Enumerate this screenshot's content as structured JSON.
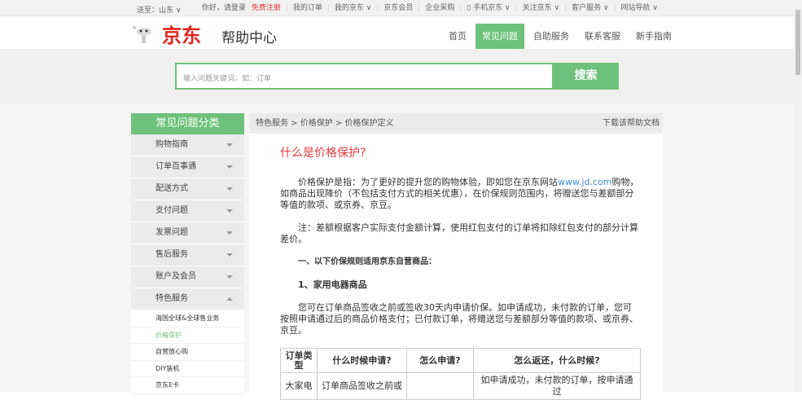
{
  "topbar": {
    "location": "送至：山东 ∨",
    "links": [
      "你好，请登录",
      "免费注册",
      "我的订单",
      "我的京东 ∨",
      "京东会员",
      "企业采购",
      "▯ 手机京东 ∨",
      "关注京东 ∨",
      "客户服务 ∨",
      "网站导航 ∨"
    ]
  },
  "header": {
    "logo": "京东",
    "title": "帮助中心",
    "nav": [
      "首页",
      "常见问题",
      "自助服务",
      "联系客服",
      "新手指南"
    ]
  },
  "search": {
    "placeholder": "输入问题关键词，如：订单",
    "button": "搜索"
  },
  "sidebar": {
    "title": "常见问题分类",
    "items": [
      "购物指南",
      "订单百事通",
      "配送方式",
      "支付问题",
      "发票问题",
      "售后服务",
      "账户及会员",
      "特色服务"
    ],
    "subitems": [
      "海国全球&全球售业务",
      "价格保护",
      "自营放心购",
      "DIY装机",
      "京东E卡"
    ]
  },
  "breadcrumb": {
    "path": "特色服务 > 价格保护 > 价格保护定义",
    "download": "下载该帮助文档"
  },
  "article": {
    "title": "什么是价格保护?",
    "p1a": "价格保护是指：为了更好的提升您的购物体验，即如您在京东网站",
    "link": "www.jd.com",
    "p1b": "购物，如商品出现降价（不包括支付方式的相关优惠），在价保规则范围内，将赠送您与差额部分等值的款项、或京券、京豆。",
    "p2": "注：差额根据客户实际支付金额计算，使用红包支付的订单将扣除红包支付的部分计算差价。",
    "h1": "一、以下价保规则适用京东自营商品：",
    "h2": "1、家用电器商品",
    "p3": "您可在订单商品签收之前或签收30天内申请价保。如申请成功，未付款的订单，您可按照申请通过后的商品价格支付；已付款订单，将赠送您与差额部分等值的款项、或京券、京豆。",
    "table": {
      "headers": [
        "订单类型",
        "什么时候申请?",
        "怎么申请?",
        "怎么返还，什么时候?"
      ],
      "row": [
        "大家电",
        "订单商品签收之前或",
        "",
        "如申请成功，未付款的订单，按申请通过"
      ]
    }
  }
}
